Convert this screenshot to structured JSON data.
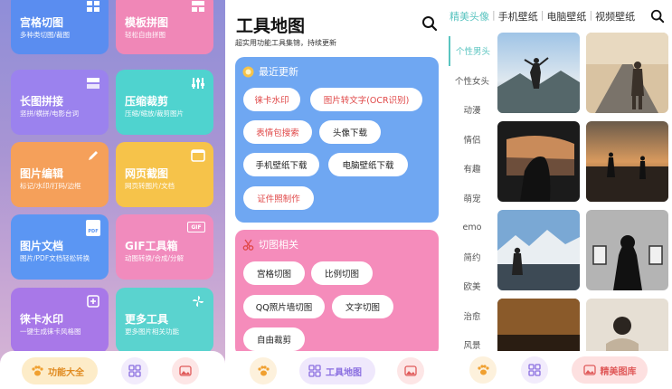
{
  "panel1": {
    "tiles": [
      {
        "title": "宫格切图",
        "subtitle": "多种类切图/裁图"
      },
      {
        "title": "模板拼图",
        "subtitle": "轻松自由拼图"
      },
      {
        "title": "长图拼接",
        "subtitle": "竖拼/横拼/电影台词"
      },
      {
        "title": "压缩裁剪",
        "subtitle": "压缩/缩放/裁剪图片"
      },
      {
        "title": "图片编辑",
        "subtitle": "标记/水印/打码/边框"
      },
      {
        "title": "网页截图",
        "subtitle": "网页转图片/文档"
      },
      {
        "title": "图片文档",
        "subtitle": "图片/PDF文档轻松转换"
      },
      {
        "title": "GIF工具箱",
        "subtitle": "动图转换/合成/分解"
      },
      {
        "title": "徕卡水印",
        "subtitle": "一键生成徕卡风格图"
      },
      {
        "title": "更多工具",
        "subtitle": "更多图片相关功能"
      }
    ],
    "nav_active_label": "功能大全",
    "pdf_badge": "PDF",
    "gif_badge": "GIF"
  },
  "panel2": {
    "title": "工具地图",
    "subtitle": "超实用功能工具集锦，持续更新",
    "recent": {
      "header": "最近更新",
      "chips": [
        "徕卡水印",
        "图片转文字(OCR识别)",
        "表情包搜索",
        "头像下载",
        "手机壁纸下载",
        "电脑壁纸下载",
        "证件照制作"
      ]
    },
    "cut": {
      "header": "切图相关",
      "chips": [
        "宫格切图",
        "比例切图",
        "QQ照片墙切图",
        "文字切图",
        "自由裁剪"
      ]
    },
    "nav_active_label": "工具地图"
  },
  "panel3": {
    "tabs": [
      "精美头像",
      "手机壁纸",
      "电脑壁纸",
      "视频壁纸"
    ],
    "categories": [
      "个性男头",
      "个性女头",
      "动漫",
      "情侣",
      "有趣",
      "萌宠",
      "emo",
      "简约",
      "欧美",
      "治愈",
      "风景"
    ],
    "nav_active_label": "精美图库"
  },
  "colors": {
    "accent_teal": "#5ac4c0",
    "chip_red": "#e04848",
    "nav_orange": "#e08a1e",
    "nav_purple": "#8a6ee0",
    "nav_red": "#e05a5a"
  }
}
